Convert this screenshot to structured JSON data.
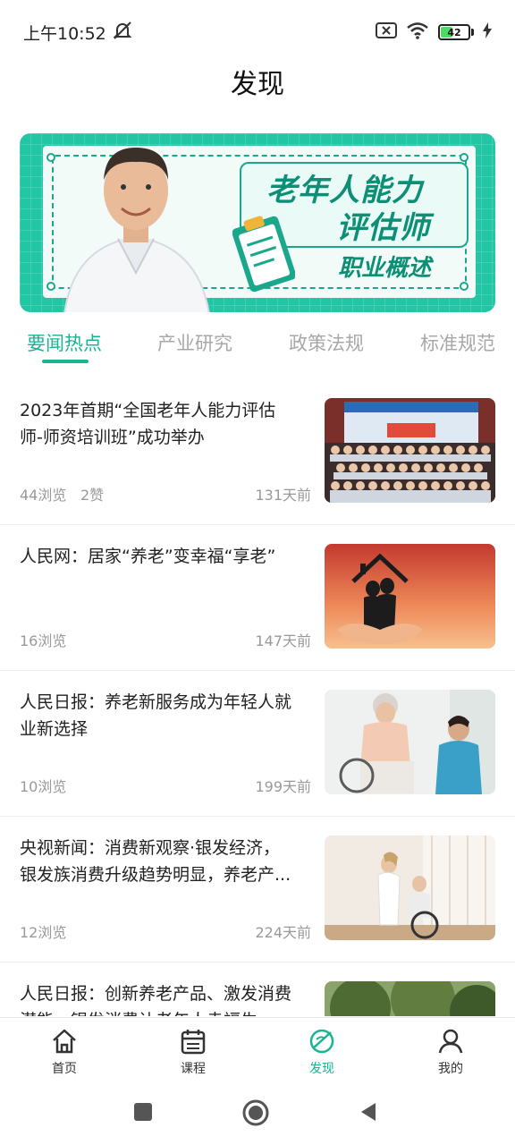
{
  "status_bar": {
    "time": "上午10:52",
    "battery_level": "42"
  },
  "header": {
    "title": "发现"
  },
  "banner": {
    "title_line1": "老年人能力",
    "title_line2": "评估师",
    "subtitle": "职业概述",
    "colors": {
      "frame": "#22c6a4",
      "text": "#0c8f75"
    }
  },
  "tabs": [
    {
      "label": "要闻热点",
      "active": true
    },
    {
      "label": "产业研究",
      "active": false
    },
    {
      "label": "政策法规",
      "active": false
    },
    {
      "label": "标准规范",
      "active": false
    }
  ],
  "news": [
    {
      "title": "2023年首期“全国老年人能力评估师-师资培训班”成功举办",
      "views": "44浏览",
      "likes": "2赞",
      "time": "131天前",
      "thumb": "group-photo"
    },
    {
      "title": "人民网：居家“养老”变幸福“享老”",
      "views": "16浏览",
      "likes": "",
      "time": "147天前",
      "thumb": "couple-in-hands"
    },
    {
      "title": "人民日报：养老新服务成为年轻人就业新选择",
      "views": "10浏览",
      "likes": "",
      "time": "199天前",
      "thumb": "nurse-with-elder"
    },
    {
      "title": "央视新闻：消费新观察·银发经济，银发族消费升级趋势明显，养老产...",
      "views": "12浏览",
      "likes": "",
      "time": "224天前",
      "thumb": "wheelchair-care"
    },
    {
      "title": "人民日报：创新养老产品、激发消费潜能，银发消费让老年人幸福生",
      "views": "",
      "likes": "",
      "time": "",
      "thumb": "trees"
    }
  ],
  "bottom_nav": [
    {
      "label": "首页",
      "icon": "home-icon",
      "active": false
    },
    {
      "label": "课程",
      "icon": "calendar-icon",
      "active": false
    },
    {
      "label": "发现",
      "icon": "discover-icon",
      "active": true
    },
    {
      "label": "我的",
      "icon": "person-icon",
      "active": false
    }
  ],
  "accent_color": "#18b493"
}
